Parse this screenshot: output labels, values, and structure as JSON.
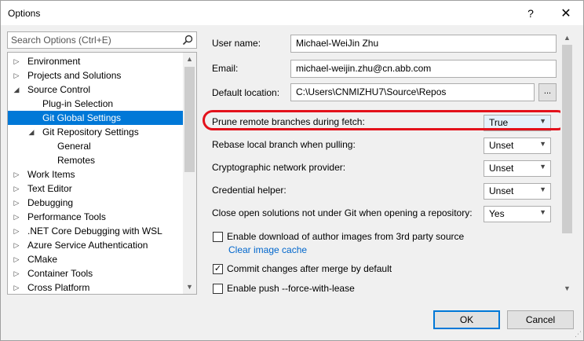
{
  "window": {
    "title": "Options",
    "help_glyph": "?",
    "close_glyph": "✕"
  },
  "search": {
    "placeholder": "Search Options (Ctrl+E)"
  },
  "tree": {
    "items": [
      {
        "label": "Environment",
        "expander": "▷",
        "level": 0
      },
      {
        "label": "Projects and Solutions",
        "expander": "▷",
        "level": 0
      },
      {
        "label": "Source Control",
        "expander": "◢",
        "level": 0
      },
      {
        "label": "Plug-in Selection",
        "expander": "",
        "level": 1
      },
      {
        "label": "Git Global Settings",
        "expander": "",
        "level": 1,
        "selected": true
      },
      {
        "label": "Git Repository Settings",
        "expander": "◢",
        "level": 1
      },
      {
        "label": "General",
        "expander": "",
        "level": 2
      },
      {
        "label": "Remotes",
        "expander": "",
        "level": 2
      },
      {
        "label": "Work Items",
        "expander": "▷",
        "level": 0
      },
      {
        "label": "Text Editor",
        "expander": "▷",
        "level": 0
      },
      {
        "label": "Debugging",
        "expander": "▷",
        "level": 0
      },
      {
        "label": "Performance Tools",
        "expander": "▷",
        "level": 0
      },
      {
        "label": ".NET Core Debugging with WSL",
        "expander": "▷",
        "level": 0
      },
      {
        "label": "Azure Service Authentication",
        "expander": "▷",
        "level": 0
      },
      {
        "label": "CMake",
        "expander": "▷",
        "level": 0
      },
      {
        "label": "Container Tools",
        "expander": "▷",
        "level": 0
      },
      {
        "label": "Cross Platform",
        "expander": "▷",
        "level": 0
      }
    ]
  },
  "fields": {
    "user_name": {
      "label": "User name:",
      "value": "Michael-WeiJin Zhu"
    },
    "email": {
      "label": "Email:",
      "value": "michael-weijin.zhu@cn.abb.com"
    },
    "default_location": {
      "label": "Default location:",
      "value": "C:\\Users\\CNMIZHU7\\Source\\Repos",
      "browse_label": "..."
    }
  },
  "settings": [
    {
      "label": "Prune remote branches during fetch:",
      "value": "True"
    },
    {
      "label": "Rebase local branch when pulling:",
      "value": "Unset"
    },
    {
      "label": "Cryptographic network provider:",
      "value": "Unset"
    },
    {
      "label": "Credential helper:",
      "value": "Unset"
    },
    {
      "label": "Close open solutions not under Git when opening a repository:",
      "value": "Yes"
    }
  ],
  "checkboxes": [
    {
      "label": "Enable download of author images from 3rd party source",
      "checked": false,
      "mark": ""
    },
    {
      "label": "Commit changes after merge by default",
      "checked": true,
      "mark": "✓"
    },
    {
      "label": "Enable push --force-with-lease",
      "checked": false,
      "mark": ""
    }
  ],
  "clear_image_cache": "Clear image cache",
  "buttons": {
    "ok": "OK",
    "cancel": "Cancel"
  },
  "colors": {
    "selection": "#0078d7",
    "highlight_ring": "#e3111b",
    "link": "#0066cc"
  }
}
